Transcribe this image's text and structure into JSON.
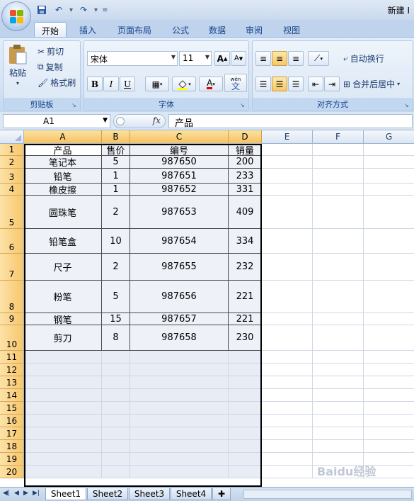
{
  "app": {
    "title": "新建 I"
  },
  "qat": {
    "save_icon": "save-icon",
    "undo_icon": "undo-icon",
    "redo_icon": "redo-icon"
  },
  "tabs": [
    "开始",
    "插入",
    "页面布局",
    "公式",
    "数据",
    "审阅",
    "视图"
  ],
  "ribbon": {
    "clipboard": {
      "label": "剪贴板",
      "paste": "粘贴",
      "cut": "剪切",
      "copy": "复制",
      "format_painter": "格式刷"
    },
    "font": {
      "label": "字体",
      "font_name": "宋体",
      "font_size": "11",
      "grow": "A",
      "shrink": "A",
      "bold": "B",
      "italic": "I",
      "underline": "U",
      "font_color": "A",
      "phonetic_guide": "wén",
      "phonetic_char": "文"
    },
    "align": {
      "label": "对齐方式",
      "wrap": "自动换行",
      "merge": "合并后居中"
    }
  },
  "formula_bar": {
    "name_box": "A1",
    "fx": "fx",
    "value": "产品"
  },
  "columns": [
    "A",
    "B",
    "C",
    "D",
    "E",
    "F",
    "G"
  ],
  "rows": [
    "1",
    "2",
    "3",
    "4",
    "5",
    "6",
    "7",
    "8",
    "9",
    "10",
    "11",
    "12",
    "13",
    "14",
    "15",
    "16",
    "17",
    "18",
    "19",
    "20"
  ],
  "table": {
    "header": [
      "产品",
      "售价",
      "编号",
      "销量"
    ],
    "rows": [
      [
        "笔记本",
        "5",
        "987650",
        "200"
      ],
      [
        "铅笔",
        "1",
        "987651",
        "233"
      ],
      [
        "橡皮擦",
        "1",
        "987652",
        "331"
      ],
      [
        "圆珠笔",
        "2",
        "987653",
        "409"
      ],
      [
        "铅笔盒",
        "10",
        "987654",
        "334"
      ],
      [
        "尺子",
        "2",
        "987655",
        "232"
      ],
      [
        "粉笔",
        "5",
        "987656",
        "221"
      ],
      [
        "钢笔",
        "15",
        "987657",
        "221"
      ],
      [
        "剪刀",
        "8",
        "987658",
        "230"
      ]
    ]
  },
  "sheets": [
    "Sheet1",
    "Sheet2",
    "Sheet3",
    "Sheet4"
  ],
  "watermark": "Baidu经验"
}
